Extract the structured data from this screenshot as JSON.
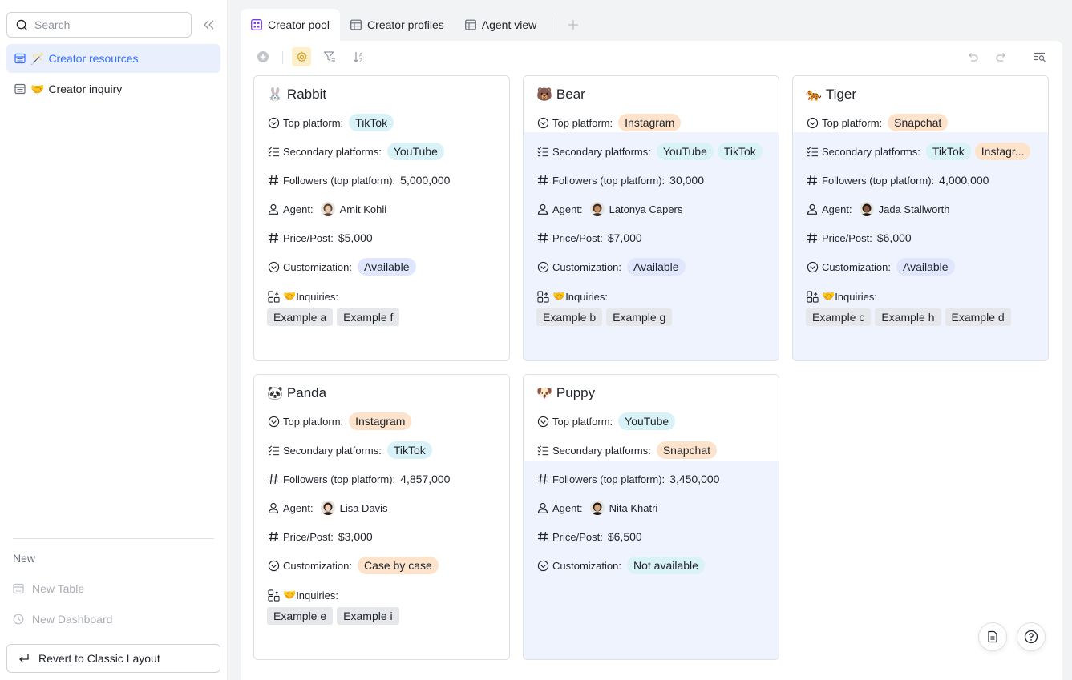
{
  "sidebar": {
    "search_placeholder": "Search",
    "items": [
      {
        "emoji": "🪄",
        "label": "Creator resources",
        "active": true
      },
      {
        "emoji": "🤝",
        "label": "Creator inquiry",
        "active": false
      }
    ],
    "new_label": "New",
    "new_table": "New Table",
    "new_dashboard": "New Dashboard",
    "revert_label": "Revert to Classic Layout"
  },
  "tabs": [
    {
      "label": "Creator pool",
      "active": true,
      "icon": "gallery-icon"
    },
    {
      "label": "Creator profiles",
      "active": false,
      "icon": "grid-icon"
    },
    {
      "label": "Agent view",
      "active": false,
      "icon": "grid-icon"
    }
  ],
  "labels": {
    "top_platform": "Top platform:",
    "secondary_platforms": "Secondary platforms:",
    "followers": "Followers (top platform):",
    "agent": "Agent:",
    "price": "Price/Post:",
    "customization": "Customization:",
    "inquiries": "Inquiries:",
    "inquiries_emoji": "🤝"
  },
  "colors": {
    "accent": "#3370ff",
    "tag_blue": "#d9f2f7",
    "tag_orange": "#fde3cc",
    "tag_lavender": "#e0e7fd",
    "highlight": "#eef3fd"
  },
  "cards": [
    {
      "emoji": "🐰",
      "name": "Rabbit",
      "top_platform": {
        "text": "TikTok",
        "color": "blue"
      },
      "secondary": [
        {
          "text": "YouTube",
          "color": "blue"
        }
      ],
      "followers": "5,000,000",
      "agent": "Amit Kohli",
      "price": "$5,000",
      "customization": {
        "text": "Available",
        "color": "lav"
      },
      "inquiries": [
        "Example a",
        "Example f"
      ]
    },
    {
      "emoji": "🐻",
      "name": "Bear",
      "top_platform": {
        "text": "Instagram",
        "color": "orange"
      },
      "secondary": [
        {
          "text": "YouTube",
          "color": "blue"
        },
        {
          "text": "TikTok",
          "color": "blue"
        }
      ],
      "followers": "30,000",
      "agent": "Latonya Capers",
      "price": "$7,000",
      "customization": {
        "text": "Available",
        "color": "lav"
      },
      "inquiries": [
        "Example b",
        "Example g"
      ]
    },
    {
      "emoji": "🐅",
      "name": "Tiger",
      "top_platform": {
        "text": "Snapchat",
        "color": "orange"
      },
      "secondary": [
        {
          "text": "TikTok",
          "color": "blue"
        },
        {
          "text": "Instagr...",
          "color": "orange"
        }
      ],
      "followers": "4,000,000",
      "agent": "Jada Stallworth",
      "price": "$6,000",
      "customization": {
        "text": "Available",
        "color": "lav"
      },
      "inquiries": [
        "Example c",
        "Example h",
        "Example d"
      ]
    },
    {
      "emoji": "🐼",
      "name": "Panda",
      "top_platform": {
        "text": "Instagram",
        "color": "orange"
      },
      "secondary": [
        {
          "text": "TikTok",
          "color": "blue"
        }
      ],
      "followers": "4,857,000",
      "agent": "Lisa Davis",
      "price": "$3,000",
      "customization": {
        "text": "Case by case",
        "color": "orange"
      },
      "inquiries": [
        "Example e",
        "Example i"
      ]
    },
    {
      "emoji": "🐶",
      "name": "Puppy",
      "top_platform": {
        "text": "YouTube",
        "color": "blue"
      },
      "secondary": [
        {
          "text": "Snapchat",
          "color": "orange"
        }
      ],
      "followers": "3,450,000",
      "agent": "Nita Khatri",
      "price": "$6,500",
      "customization": {
        "text": "Not available",
        "color": "blue"
      },
      "inquiries": []
    }
  ]
}
